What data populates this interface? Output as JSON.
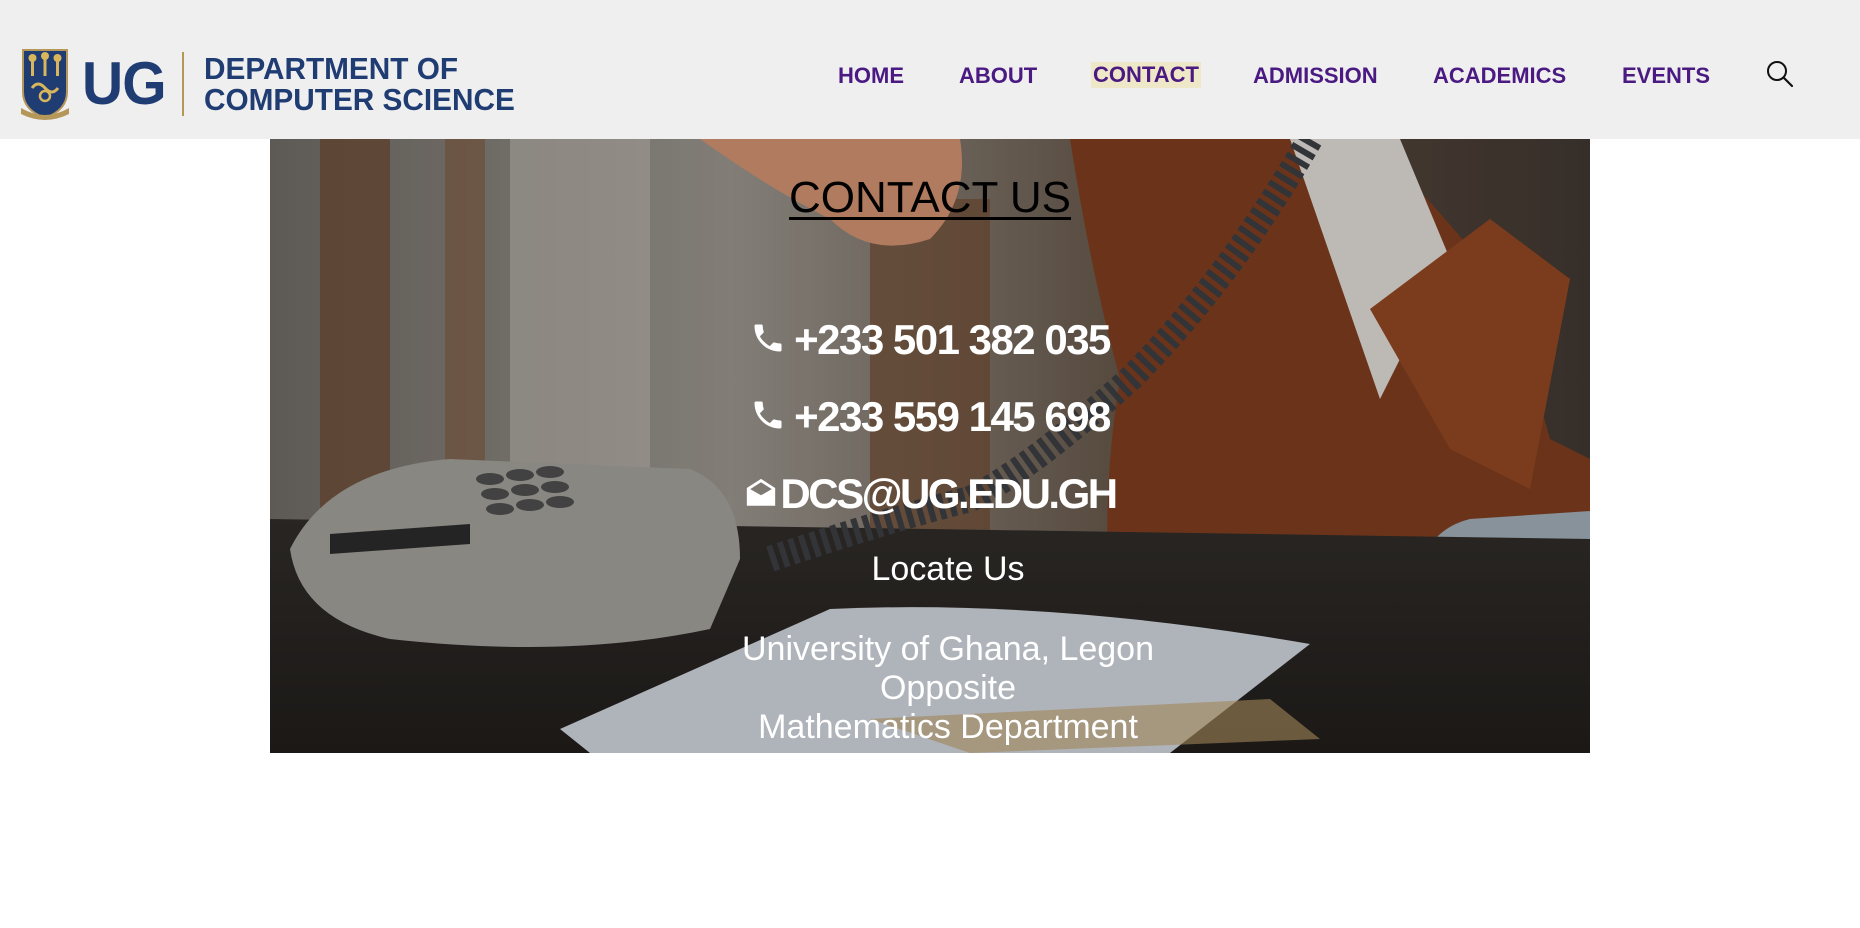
{
  "header": {
    "logo": {
      "crest_icon": "ug-crest-icon",
      "abbreviation": "UG",
      "name_line1": "DEPARTMENT OF",
      "name_line2": "COMPUTER SCIENCE"
    },
    "nav": [
      {
        "label": "HOME",
        "active": false
      },
      {
        "label": "ABOUT",
        "active": false
      },
      {
        "label": "CONTACT",
        "active": true
      },
      {
        "label": "ADMISSION",
        "active": false
      },
      {
        "label": "ACADEMICS",
        "active": false
      },
      {
        "label": "EVENTS",
        "active": false
      }
    ],
    "search_icon": "search-icon"
  },
  "contact": {
    "title": "CONTACT US",
    "phones": [
      {
        "icon": "phone-icon",
        "number": "+233 501 382 035"
      },
      {
        "icon": "phone-icon",
        "number": "+233 559 145 698"
      }
    ],
    "email": {
      "icon": "envelope-open-icon",
      "address": "DCS@UG.EDU.GH"
    },
    "locate_heading": "Locate Us",
    "address_lines": [
      "University of Ghana, Legon",
      "Opposite",
      "Mathematics Department"
    ]
  },
  "colors": {
    "header_bg": "#efefef",
    "nav_text": "#4a1a82",
    "nav_active_bg": "#efe8c8",
    "logo_blue": "#1f3c73",
    "logo_gold": "#b6975a"
  }
}
